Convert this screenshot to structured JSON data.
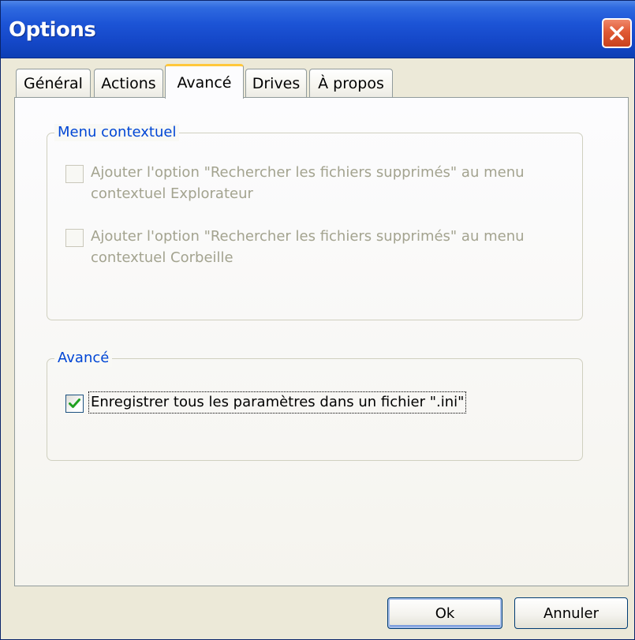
{
  "window": {
    "title": "Options",
    "close_icon": "close-icon"
  },
  "tabs": [
    {
      "label": "Général",
      "active": false
    },
    {
      "label": "Actions",
      "active": false
    },
    {
      "label": "Avancé",
      "active": true
    },
    {
      "label": "Drives",
      "active": false
    },
    {
      "label": "À propos",
      "active": false
    }
  ],
  "context_menu_group": {
    "legend": "Menu contextuel",
    "items": [
      {
        "line1": "Ajouter l'option \"Rechercher les fichiers supprimés\" au menu",
        "line2": "contextuel Explorateur",
        "checked": false,
        "enabled": false
      },
      {
        "line1": "Ajouter l'option \"Rechercher les fichiers supprimés\" au menu",
        "line2": "contextuel Corbeille",
        "checked": false,
        "enabled": false
      }
    ]
  },
  "advanced_group": {
    "legend": "Avancé",
    "items": [
      {
        "label": "Enregistrer tous les paramètres dans un fichier \".ini\"",
        "checked": true,
        "enabled": true
      }
    ]
  },
  "buttons": {
    "ok": "Ok",
    "cancel": "Annuler"
  },
  "colors": {
    "titlebar": "#1c54d6",
    "legend_text": "#0046d5",
    "disabled_text": "#a3a38f",
    "check_mark": "#21a121",
    "active_tab_highlight": "#ffc83c"
  }
}
